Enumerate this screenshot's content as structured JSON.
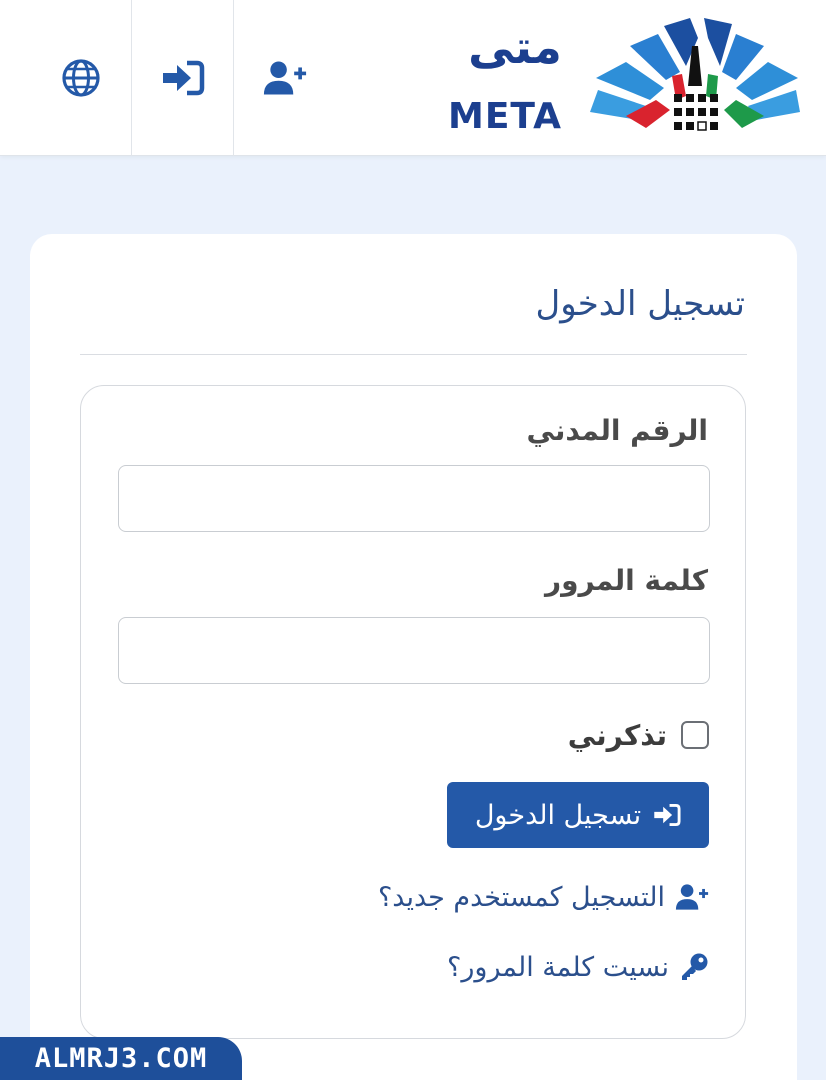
{
  "header": {
    "nav": [
      {
        "name": "language",
        "icon": "globe-icon"
      },
      {
        "name": "login",
        "icon": "sign-in-icon"
      },
      {
        "name": "register",
        "icon": "user-plus-icon"
      }
    ],
    "logo_ar": "متى",
    "logo_en": "META"
  },
  "login_card": {
    "title": "تسجيل الدخول",
    "civil_id_label": "الرقم المدني",
    "civil_id_value": "",
    "password_label": "كلمة المرور",
    "password_value": "",
    "remember_label": "تذكرني",
    "submit_label": "تسجيل الدخول",
    "register_link": "التسجيل كمستخدم جديد؟",
    "forgot_link": "نسيت كلمة المرور؟"
  },
  "watermark": "ALMRJ3.COM",
  "colors": {
    "primary": "#2459a8",
    "link": "#2b4f8c",
    "page_bg": "#eaf1fc"
  }
}
